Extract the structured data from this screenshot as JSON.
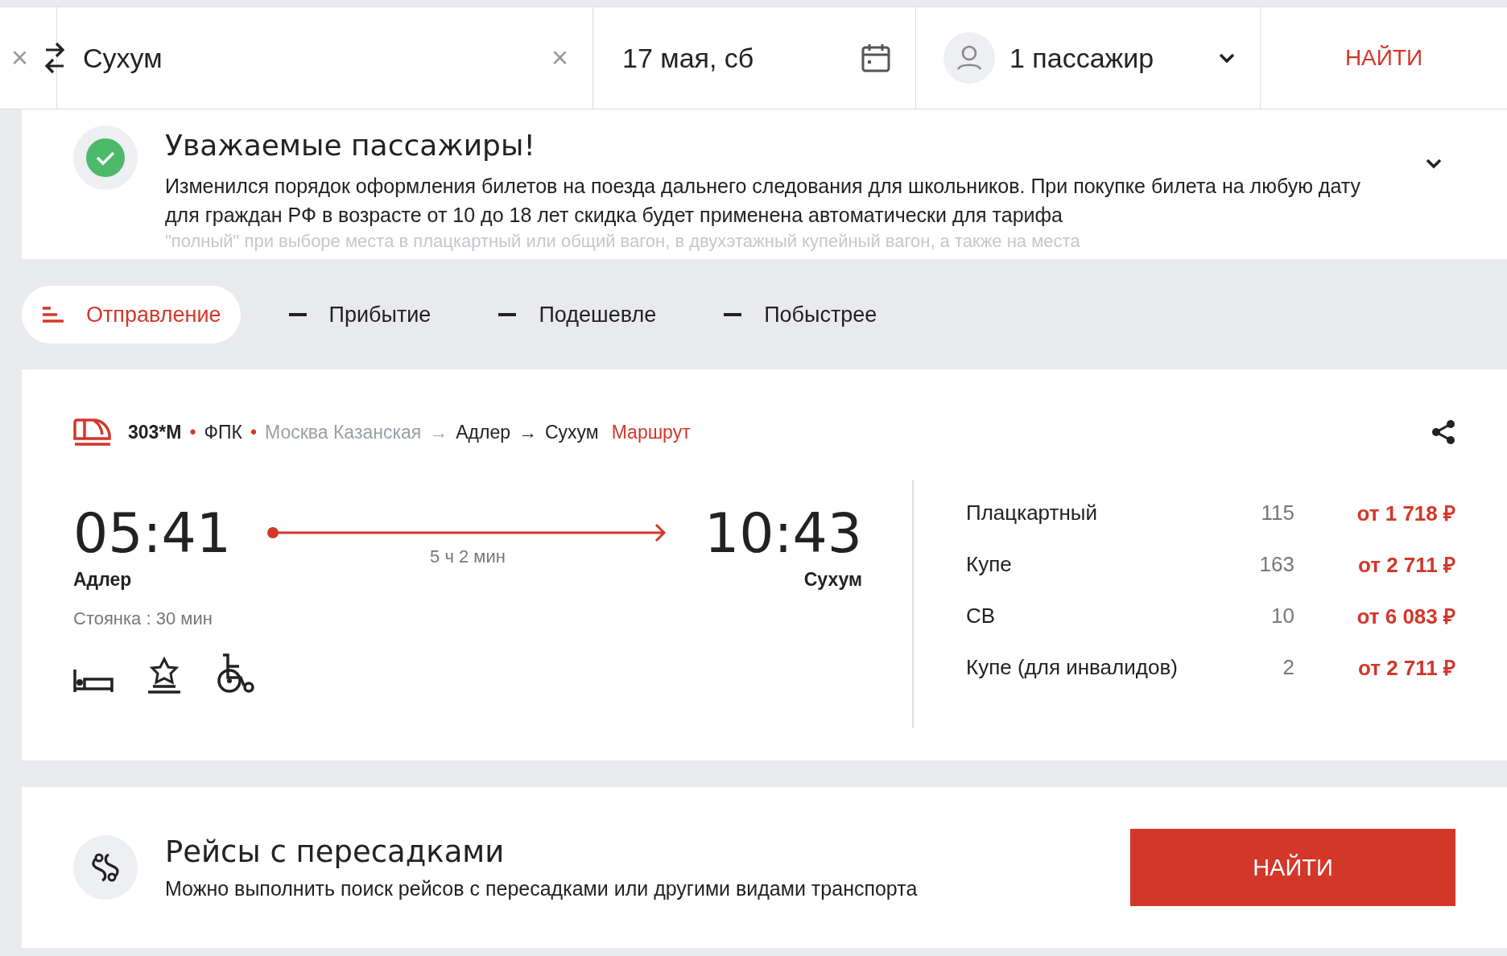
{
  "search": {
    "clear_left": "×",
    "origin": "Сухум",
    "clear_right": "×",
    "date": "17 мая, сб",
    "passengers": "1 пассажир",
    "find": "НАЙТИ"
  },
  "notice": {
    "title": "Уважаемые пассажиры!",
    "text": "Изменился порядок оформления билетов на поезда дальнего следования для школьников. При покупке билета на любую дату для граждан РФ в возрасте от 10 до 18 лет скидка будет применена автоматически для тарифа",
    "faded_text": "\"полный\" при выборе места в плацкартный или общий вагон, в двухэтажный купейный вагон, а также на места"
  },
  "sort_tabs": [
    {
      "label": "Отправление",
      "selected": true
    },
    {
      "label": "Прибытие",
      "selected": false
    },
    {
      "label": "Подешевле",
      "selected": false
    },
    {
      "label": "Побыстрее",
      "selected": false
    }
  ],
  "train": {
    "number": "303*М",
    "carrier": "ФПК",
    "separator": "•",
    "route": [
      {
        "station": "Москва Казанская",
        "muted": true
      },
      {
        "station": "Адлер",
        "muted": false
      },
      {
        "station": "Сухум",
        "muted": false
      }
    ],
    "route_arrow": "→",
    "route_link": "Маршрут",
    "departure": {
      "time": "05:41",
      "station": "Адлер",
      "stop": "Стоянка : 30 мин"
    },
    "duration": "5 ч 2 мин",
    "arrival": {
      "time": "10:43",
      "station": "Сухум"
    },
    "classes": [
      {
        "name": "Плацкартный",
        "seats": "115",
        "price": "от 1 718 ₽"
      },
      {
        "name": "Купе",
        "seats": "163",
        "price": "от 2 711 ₽"
      },
      {
        "name": "СВ",
        "seats": "10",
        "price": "от 6 083 ₽"
      },
      {
        "name": "Купе (для инвалидов)",
        "seats": "2",
        "price": "от 2 711 ₽"
      }
    ]
  },
  "transfers": {
    "title": "Рейсы с пересадками",
    "text": "Можно выполнить поиск рейсов с пересадками или другими видами транспорта",
    "button": "НАЙТИ"
  }
}
